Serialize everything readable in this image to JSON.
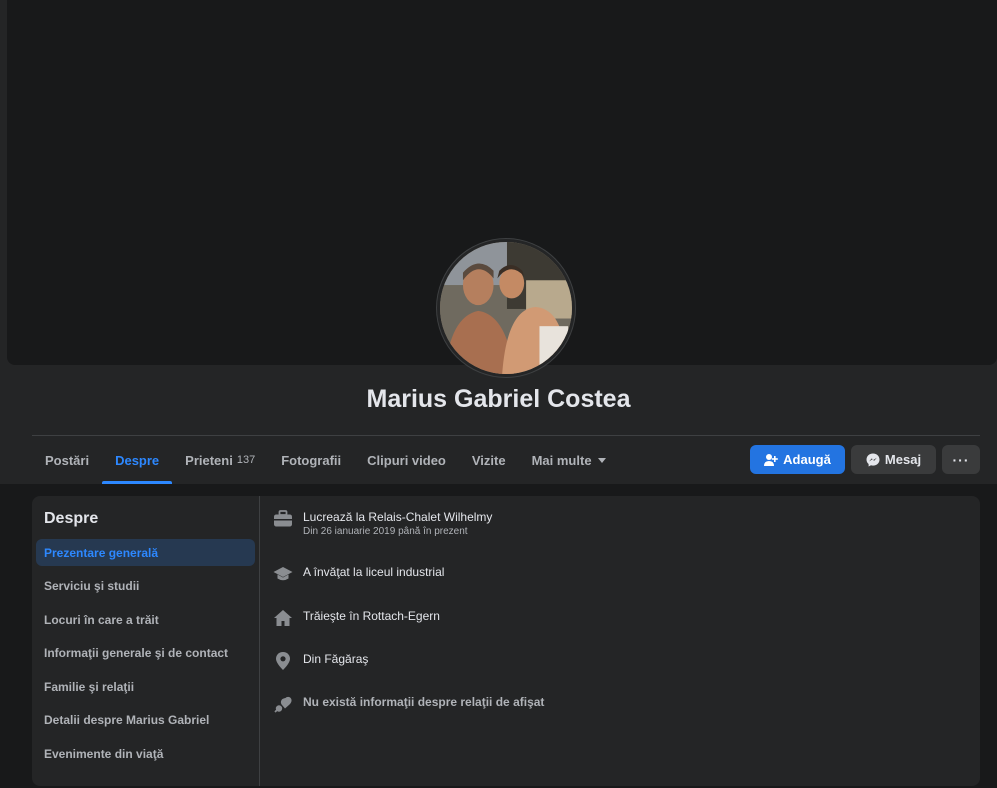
{
  "profile": {
    "name": "Marius Gabriel Costea"
  },
  "tabs": [
    {
      "label": "Postări"
    },
    {
      "label": "Despre"
    },
    {
      "label": "Prieteni",
      "count": "137"
    },
    {
      "label": "Fotografii"
    },
    {
      "label": "Clipuri video"
    },
    {
      "label": "Vizite"
    },
    {
      "label": "Mai multe"
    }
  ],
  "actions": {
    "add_label": "Adaugă",
    "message_label": "Mesaj",
    "more_label": "···"
  },
  "about": {
    "title": "Despre",
    "menu": [
      {
        "label": "Prezentare generală"
      },
      {
        "label": "Serviciu şi studii"
      },
      {
        "label": "Locuri în care a trăit"
      },
      {
        "label": "Informaţii generale şi de contact"
      },
      {
        "label": "Familie şi relaţii"
      },
      {
        "label": "Detalii despre Marius Gabriel"
      },
      {
        "label": "Evenimente din viaţă"
      }
    ],
    "overview": {
      "work": "Lucrează la Relais-Chalet Wilhelmy",
      "work_since": "Din 26 ianuarie 2019 până în prezent",
      "education": "A învăţat la liceul industrial",
      "lives": "Trăieşte în Rottach-Egern",
      "from": "Din Făgăraş",
      "relationship": "Nu există informaţii despre relaţii de afişat"
    }
  },
  "colors": {
    "accent": "#2d88ff",
    "primary_button": "#2374e1",
    "surface": "#242526",
    "background": "#18191a"
  }
}
